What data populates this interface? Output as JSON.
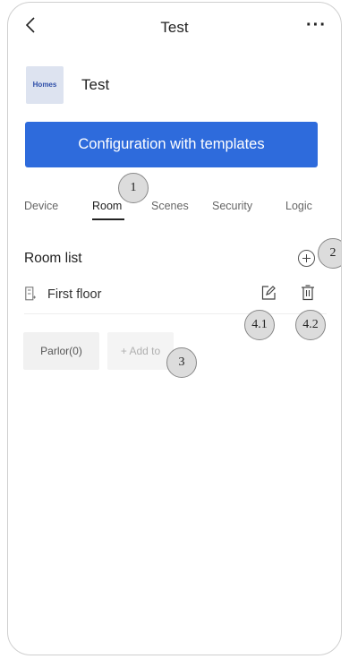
{
  "header": {
    "title": "Test",
    "back_icon": "chevron-left-icon",
    "more_label": "···"
  },
  "home": {
    "logo_text": "Homes",
    "name": "Test"
  },
  "config_button_label": "Configuration with templates",
  "tabs": [
    {
      "label": "Device",
      "active": false
    },
    {
      "label": "Room",
      "active": true
    },
    {
      "label": "Scenes",
      "active": false
    },
    {
      "label": "Security",
      "active": false
    },
    {
      "label": "Logic",
      "active": false
    }
  ],
  "room_list": {
    "title": "Room list",
    "add_icon": "plus-circle-icon",
    "floors": [
      {
        "name": "First floor",
        "icon": "floor-icon",
        "edit_icon": "edit-icon",
        "delete_icon": "trash-icon",
        "rooms": [
          {
            "label": "Parlor(0)"
          }
        ],
        "add_label": "+ Add to"
      }
    ]
  },
  "callouts": [
    "1",
    "2",
    "3",
    "4.1",
    "4.2"
  ],
  "colors": {
    "primary": "#2e6bdc",
    "logo_bg": "#dde3f0",
    "logo_text": "#2d4ea8",
    "callout_bg": "#dcdcdc"
  }
}
